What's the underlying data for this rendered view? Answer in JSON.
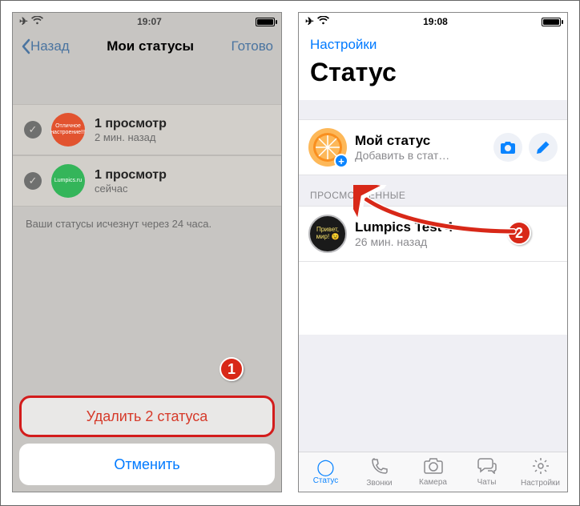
{
  "left": {
    "time": "19:07",
    "nav": {
      "back": "Назад",
      "title": "Мои статусы",
      "done": "Готово"
    },
    "rows": [
      {
        "thumbText": "Отличное настроение!!!",
        "title": "1 просмотр",
        "subtitle": "2 мин. назад"
      },
      {
        "thumbText": "Lumpics.ru",
        "title": "1 просмотр",
        "subtitle": "сейчас"
      }
    ],
    "note": "Ваши статусы исчезнут через 24 часа.",
    "sheet": {
      "delete": "Удалить 2 статуса",
      "cancel": "Отменить"
    }
  },
  "right": {
    "time": "19:08",
    "settingsLink": "Настройки",
    "pageTitle": "Статус",
    "myStatus": {
      "title": "Мой статус",
      "subtitle": "Добавить в стат…"
    },
    "viewedHeader": "ПРОСМОТРЕННЫЕ",
    "viewed": [
      {
        "avatarText": "Привет, мир! 😉",
        "title": "Lumpics Test 4",
        "subtitle": "26 мин. назад"
      }
    ],
    "tabs": {
      "status": "Статус",
      "calls": "Звонки",
      "camera": "Камера",
      "chats": "Чаты",
      "settings": "Настройки"
    }
  },
  "callouts": {
    "one": "1",
    "two": "2"
  }
}
